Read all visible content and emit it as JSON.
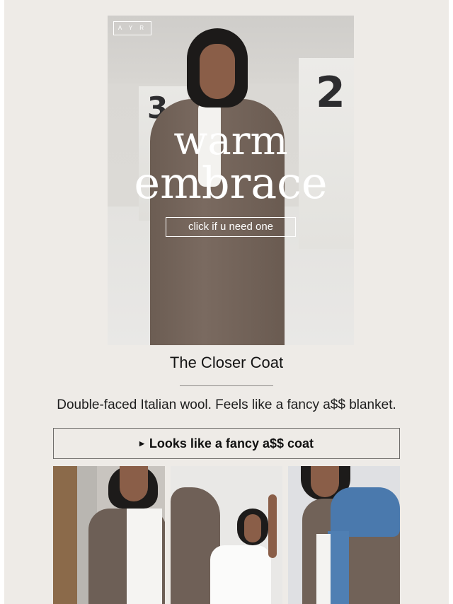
{
  "hero": {
    "logo_text": "A Y R",
    "headline_line1": "warm",
    "headline_line2": "embrace",
    "cta_label": "click if u need one",
    "sign_left": "3",
    "sign_right": "2"
  },
  "product": {
    "title": "The Closer Coat",
    "description": "Double-faced Italian wool. Feels like a fancy a$$ blanket.",
    "button_label": "Looks like a fancy a$$ coat"
  },
  "gallery": {
    "items": [
      "coat-detail-photo",
      "coat-swing-photo",
      "coat-denim-photo"
    ]
  },
  "colors": {
    "background": "#eeebe7",
    "coat": "#6c5d53",
    "text": "#141414"
  }
}
